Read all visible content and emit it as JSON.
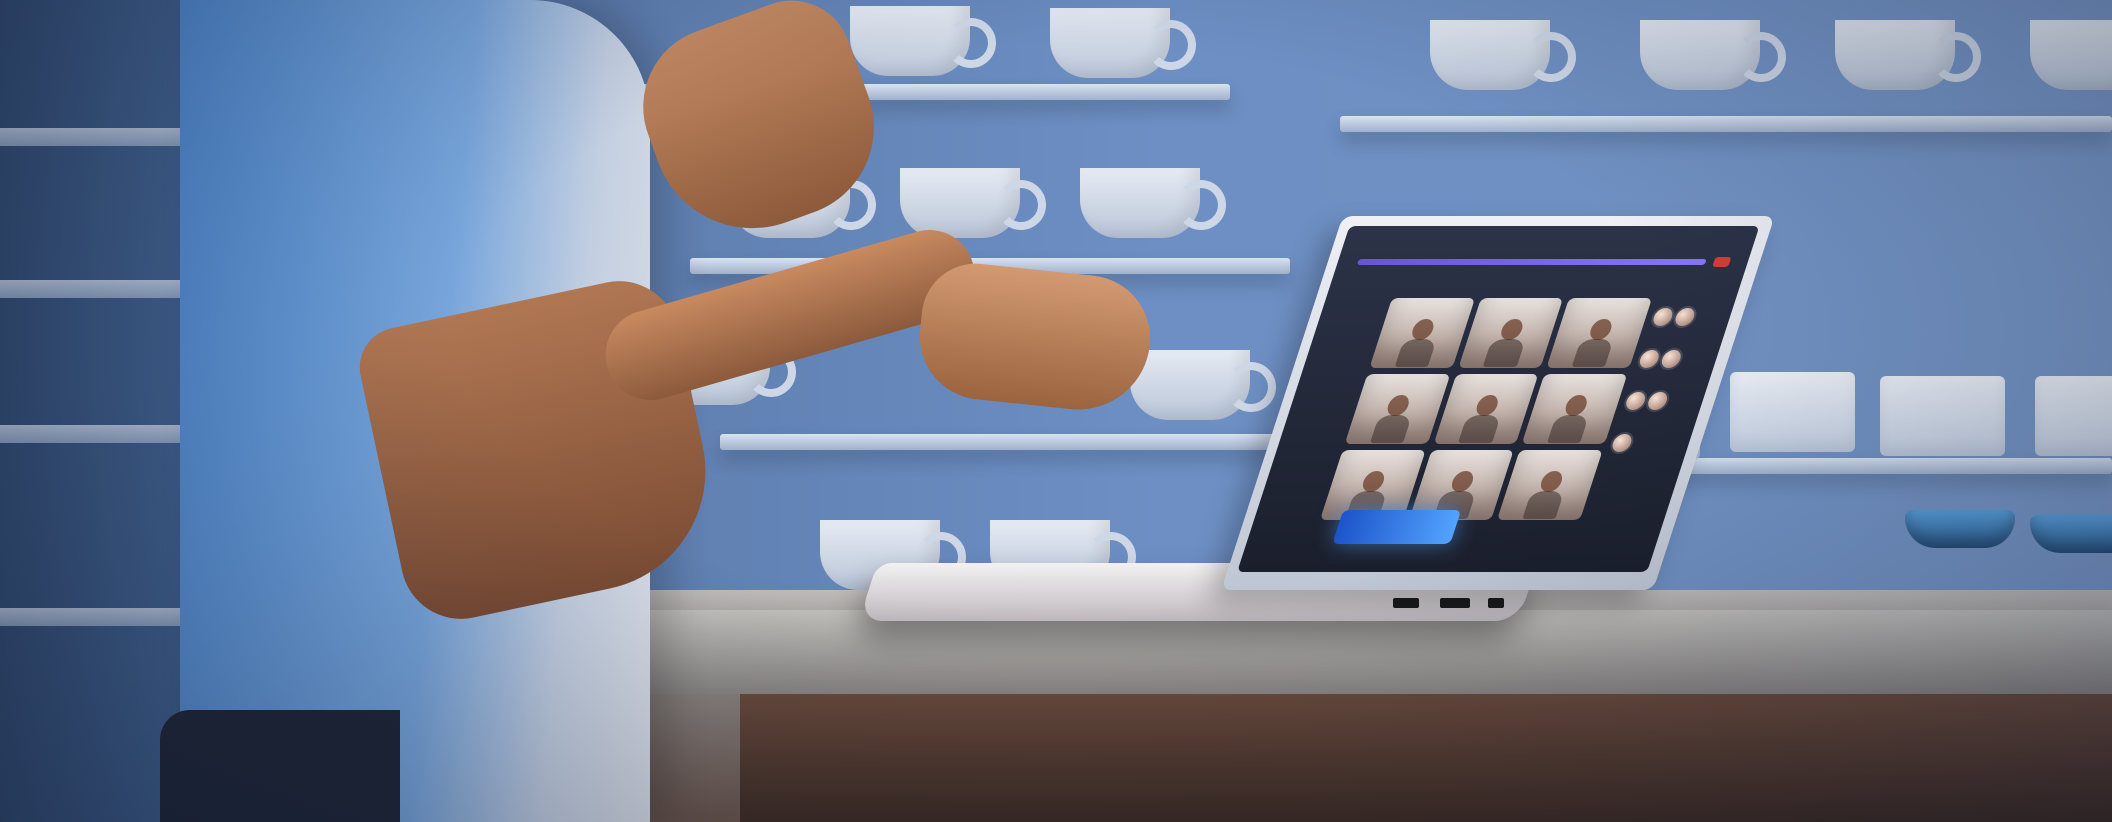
{
  "image": {
    "type": "photo",
    "scene": {
      "subject": "person",
      "device": "laptop",
      "screen_app": "video-call",
      "shelves_with_cups": true,
      "table": "wooden",
      "accent_colors": {
        "background_blue": "#6d8fc4",
        "shirt_blue": "#78a6dc",
        "table_brown": "#6a4a3b",
        "screen_dark": "#1b1f2c",
        "call_bar_purple": "#8c7bff",
        "end_call_red": "#d63b3b",
        "taskbar_glow": "#53a3ff"
      }
    }
  }
}
